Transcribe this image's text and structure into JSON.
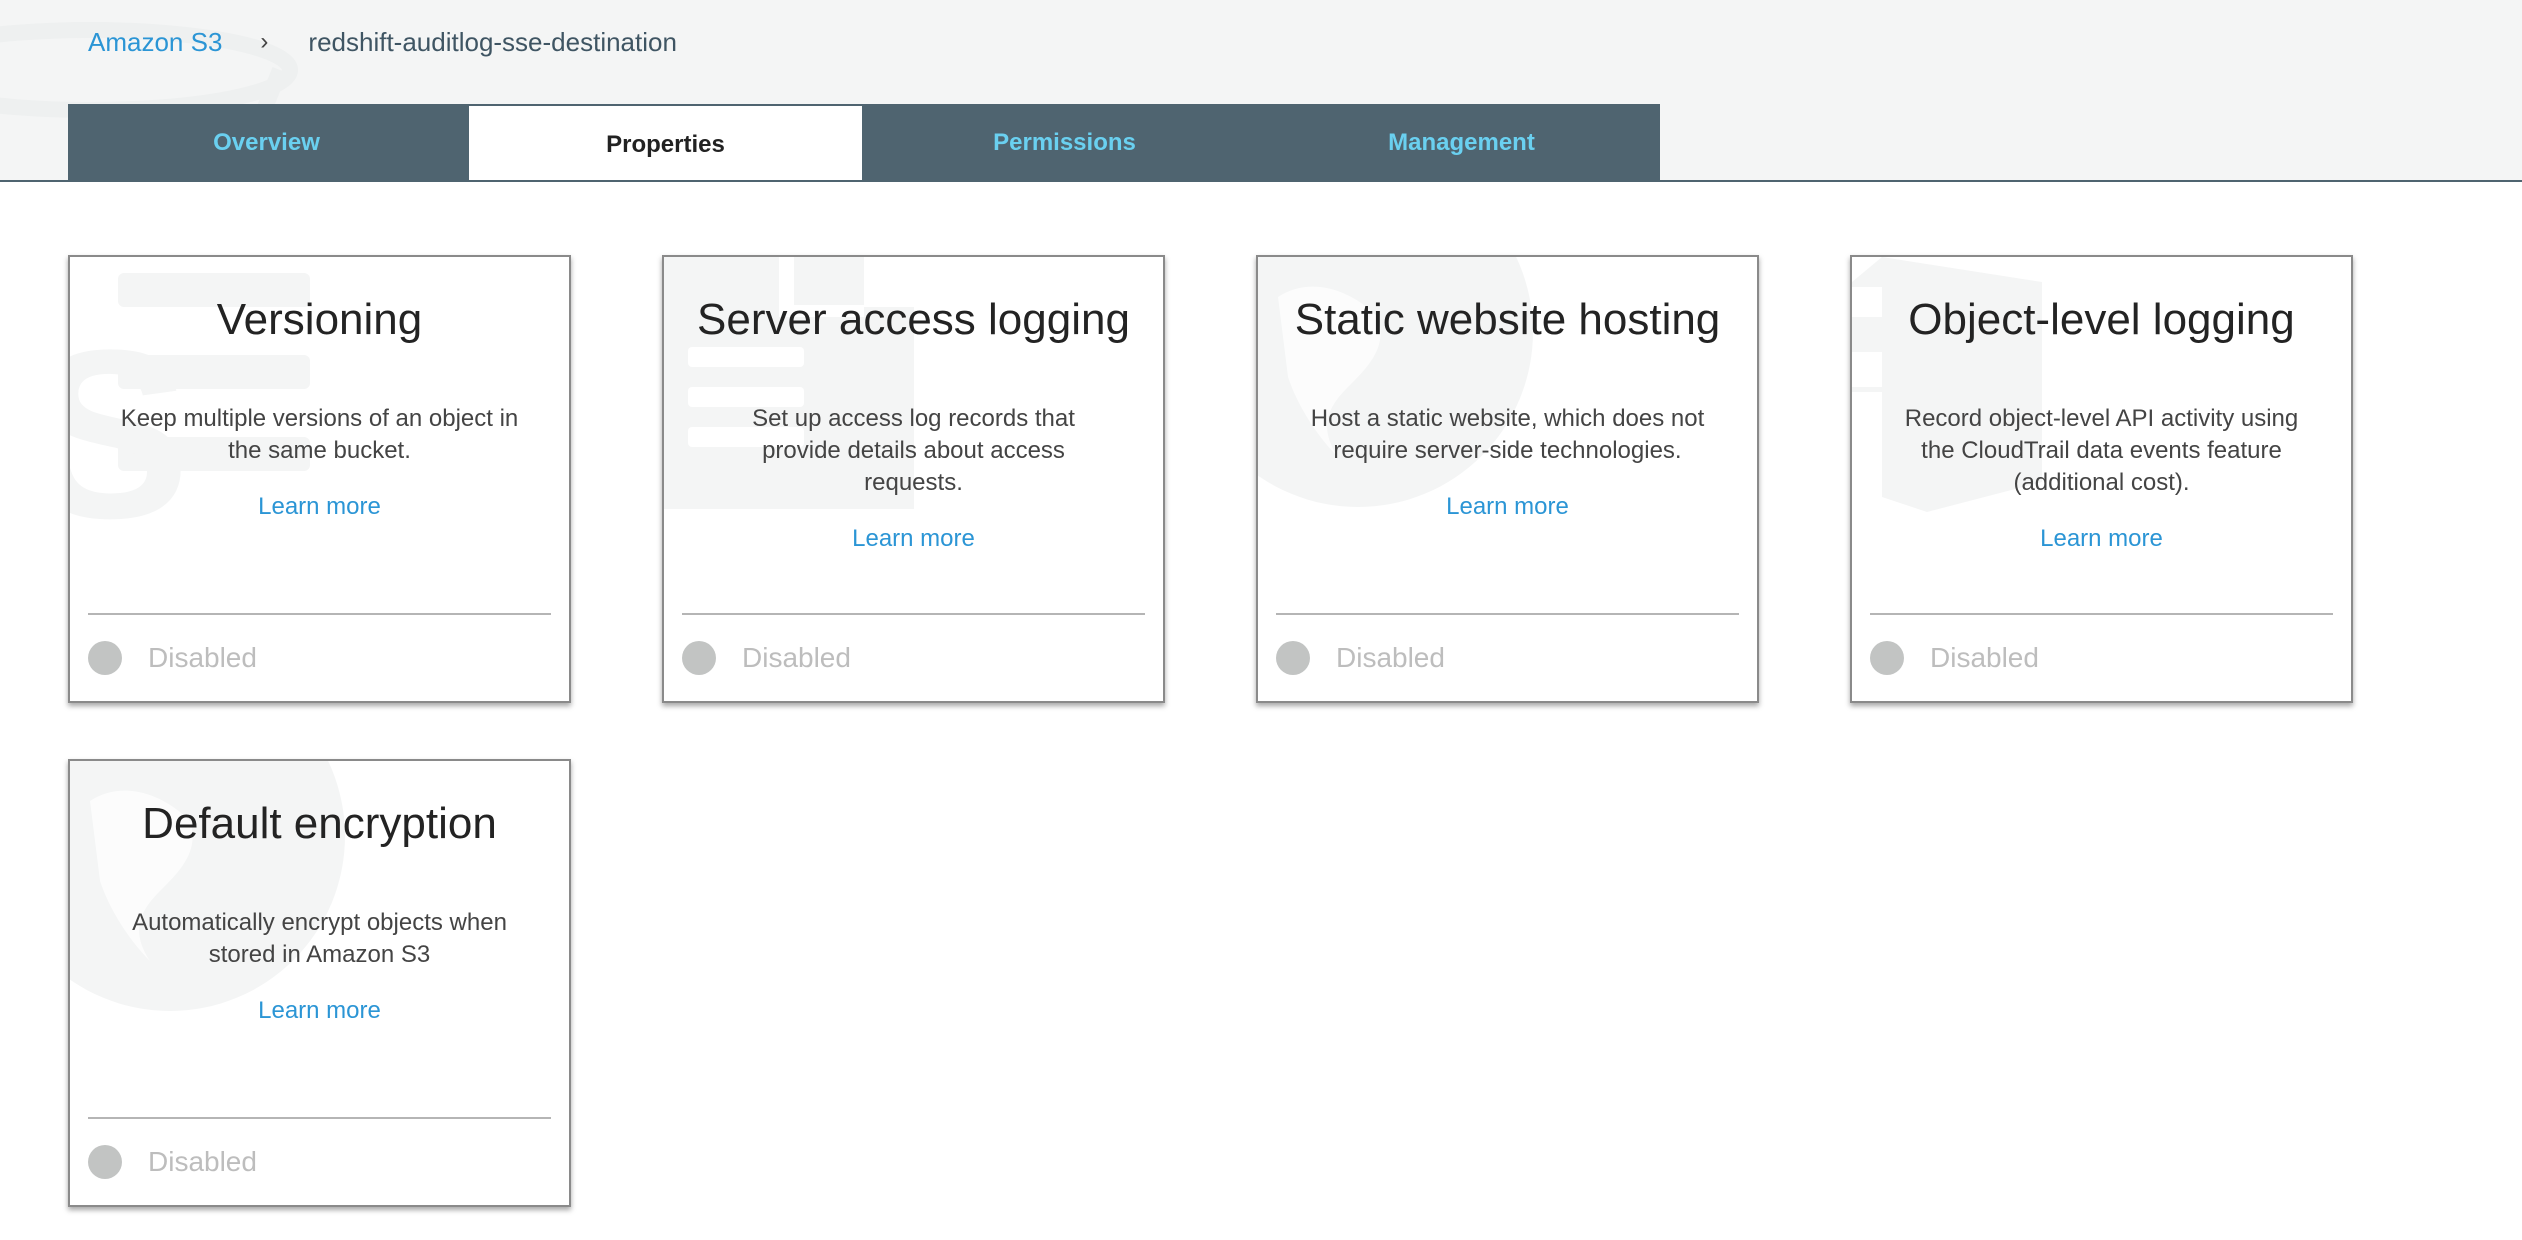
{
  "breadcrumb": {
    "root": "Amazon S3",
    "separator": "›",
    "current": "redshift-auditlog-sse-destination"
  },
  "tabs": [
    {
      "label": "Overview",
      "active": false
    },
    {
      "label": "Properties",
      "active": true
    },
    {
      "label": "Permissions",
      "active": false
    },
    {
      "label": "Management",
      "active": false
    }
  ],
  "colors": {
    "tab_bg": "#4f6470",
    "tab_text": "#6ad0f0",
    "link": "#2b95d5",
    "header_bg": "#f4f5f5"
  },
  "cards": [
    {
      "title": "Versioning",
      "description": "Keep multiple versions of an object in the same bucket.",
      "link": "Learn more",
      "status": "Disabled",
      "watermark_icon": "versioning-icon"
    },
    {
      "title": "Server access logging",
      "description": "Set up access log records that provide details about access requests.",
      "link": "Learn more",
      "status": "Disabled",
      "watermark_icon": "document-icon"
    },
    {
      "title": "Static website hosting",
      "description": "Host a static website, which does not require server-side technologies.",
      "link": "Learn more",
      "status": "Disabled",
      "watermark_icon": "globe-icon"
    },
    {
      "title": "Object-level logging",
      "description": "Record object-level API activity using the CloudTrail data events feature (additional cost).",
      "link": "Learn more",
      "status": "Disabled",
      "watermark_icon": "cloudtrail-icon"
    },
    {
      "title": "Default encryption",
      "description": "Automatically encrypt objects when stored in Amazon S3",
      "link": "Learn more",
      "status": "Disabled",
      "watermark_icon": "globe-icon"
    }
  ]
}
